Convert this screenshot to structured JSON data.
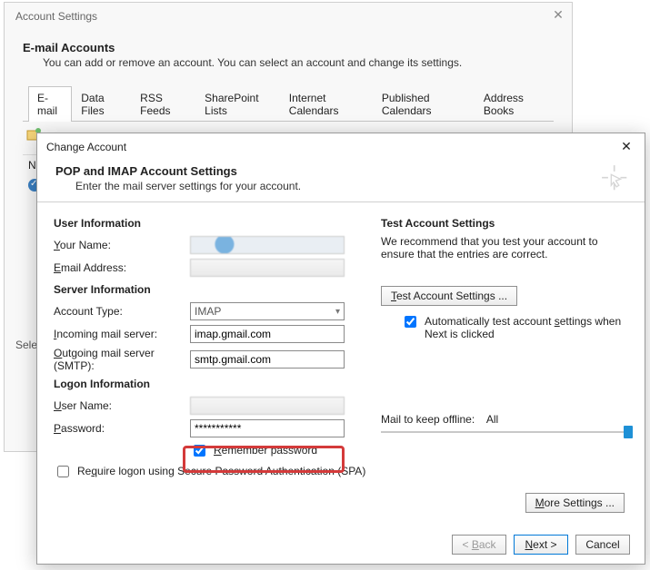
{
  "bgwin": {
    "title": "Account Settings",
    "heading": "E-mail Accounts",
    "sub": "You can add or remove an account. You can select an account and change its settings.",
    "tabs": [
      "E-mail",
      "Data Files",
      "RSS Feeds",
      "SharePoint Lists",
      "Internet Calendars",
      "Published Calendars",
      "Address Books"
    ],
    "col_header": "Na",
    "truncated_label": "Sele"
  },
  "dlg": {
    "title": "Change Account",
    "heading": "POP and IMAP Account Settings",
    "sub": "Enter the mail server settings for your account.",
    "sections": {
      "user_info": "User Information",
      "server_info": "Server Information",
      "logon_info": "Logon Information",
      "test_head": "Test Account Settings",
      "test_desc": "We recommend that you test your account to ensure that the entries are correct."
    },
    "labels": {
      "your_name": "Your Name:",
      "email": "Email Address:",
      "acct_type": "Account Type:",
      "incoming": "Incoming mail server:",
      "outgoing": "Outgoing mail server (SMTP):",
      "user_name": "User Name:",
      "password": "Password:",
      "remember_pw": "Remember password",
      "spa": "Require logon using Secure Password Authentication (SPA)",
      "auto_test": "Automatically test account settings when Next is clicked",
      "mail_keep": "Mail to keep offline:",
      "mail_keep_val": "All"
    },
    "values": {
      "acct_type": "IMAP",
      "incoming": "imap.gmail.com",
      "outgoing": "smtp.gmail.com",
      "password_masked": "***********",
      "remember_pw_checked": true,
      "spa_checked": false,
      "auto_test_checked": true
    },
    "buttons": {
      "test": "Test Account Settings ...",
      "more": "More Settings ...",
      "back": "< Back",
      "next": "Next >",
      "cancel": "Cancel"
    }
  }
}
